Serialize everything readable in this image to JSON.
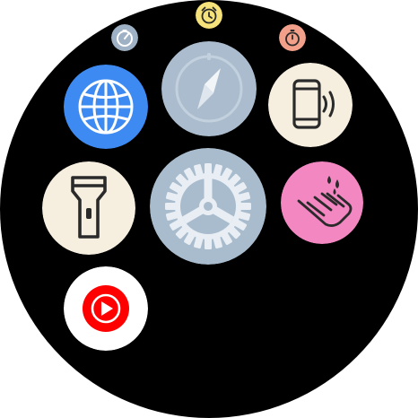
{
  "screen": "app-launcher-honeycomb",
  "apps": [
    {
      "id": "small-gauge",
      "icon": "gauge-icon",
      "color": "#9fb1c4"
    },
    {
      "id": "small-alarm",
      "icon": "alarm-clock-icon",
      "color": "#f5e27a"
    },
    {
      "id": "small-timer",
      "icon": "stopwatch-icon",
      "color": "#f2a08a"
    },
    {
      "id": "browser",
      "icon": "globe-icon",
      "color": "#3d8bf2"
    },
    {
      "id": "compass",
      "icon": "compass-icon",
      "color": "#aabccd"
    },
    {
      "id": "find-phone",
      "icon": "phone-vibrate-icon",
      "color": "#f6efe0"
    },
    {
      "id": "flashlight",
      "icon": "flashlight-icon",
      "color": "#f6efe0"
    },
    {
      "id": "settings",
      "icon": "gear-icon",
      "color": "#a9bccd"
    },
    {
      "id": "handwash",
      "icon": "handwash-icon",
      "color": "#f287c2"
    },
    {
      "id": "youtube-music",
      "icon": "youtube-music-icon",
      "color": "#ff0000"
    }
  ]
}
